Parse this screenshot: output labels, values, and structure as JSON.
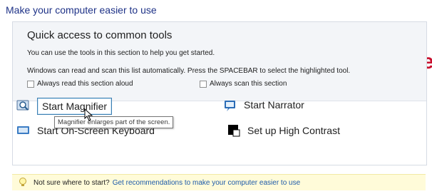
{
  "section_title": "Make your computer easier to use",
  "side_mark": "e",
  "quick_access": {
    "heading": "Quick access to common tools",
    "line1": "You can use the tools in this section to help you get started.",
    "line2": "Windows can read and scan this list automatically.  Press the SPACEBAR to select the highlighted tool.",
    "check_read": "Always read this section aloud",
    "check_scan": "Always scan this section"
  },
  "tools": {
    "magnifier": "Start Magnifier",
    "narrator": "Start Narrator",
    "osk": "Start On-Screen Keyboard",
    "contrast": "Set up High Contrast"
  },
  "tooltip": "Magnifier enlarges part of the screen.",
  "hint": {
    "text": "Not sure where to start?",
    "link": "Get recommendations to make your computer easier to use"
  },
  "colors": {
    "title": "#1e3287",
    "link": "#1e5ba9",
    "hint_bg": "#fffbd9",
    "accent_mark": "#c8102e"
  }
}
